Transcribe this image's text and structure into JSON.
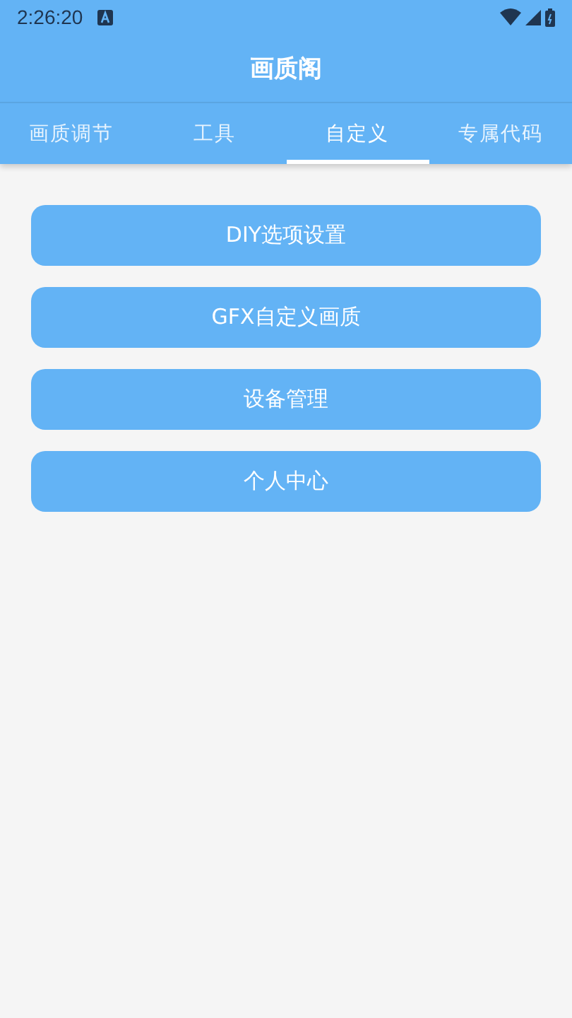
{
  "status_bar": {
    "time": "2:26:20"
  },
  "app_bar": {
    "title": "画质阁"
  },
  "tabs": [
    {
      "label": "画质调节",
      "selected": false
    },
    {
      "label": "工具",
      "selected": false
    },
    {
      "label": "自定义",
      "selected": true
    },
    {
      "label": "专属代码",
      "selected": false
    }
  ],
  "buttons": [
    "DIY选项设置",
    "GFX自定义画质",
    "设备管理",
    "个人中心"
  ]
}
